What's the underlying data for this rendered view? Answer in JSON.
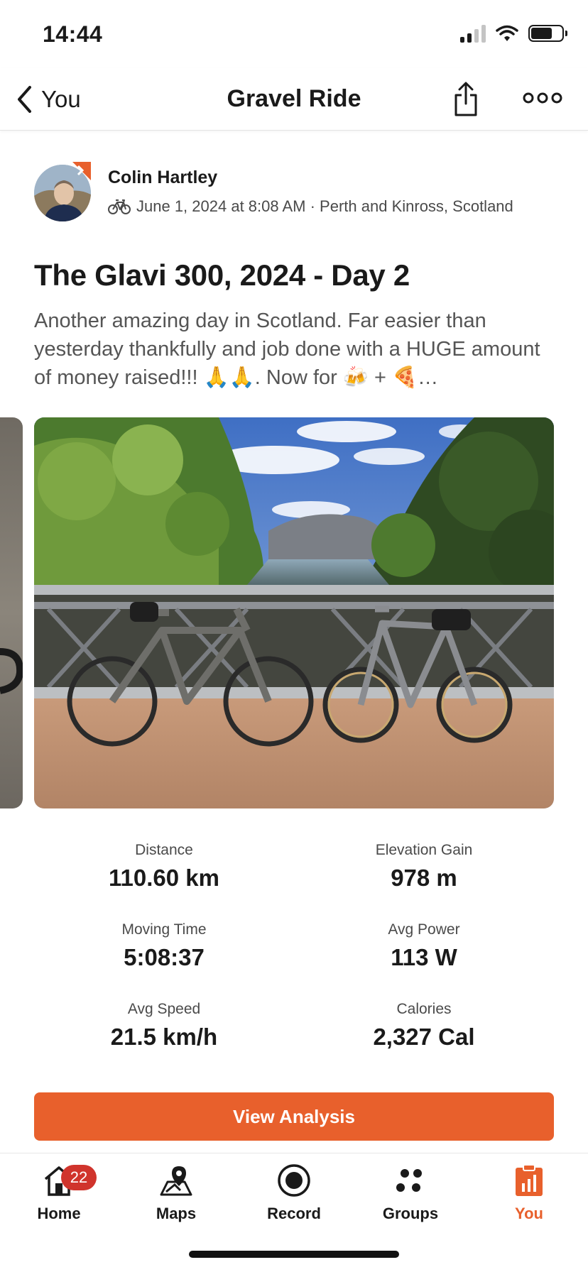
{
  "status_bar": {
    "time": "14:44"
  },
  "header": {
    "back_label": "You",
    "title": "Gravel Ride"
  },
  "author": {
    "name": "Colin Hartley",
    "meta": "June 1, 2024 at 8:08 AM · Perth and Kinross, Scotland"
  },
  "activity": {
    "title": "The Glavi 300, 2024 - Day 2",
    "description": "Another amazing day in Scotland. Far easier than yesterday thankfully and job done with a HUGE amount of money raised!!! 🙏🙏. Now for 🍻 + 🍕…"
  },
  "stats": [
    {
      "label": "Distance",
      "value": "110.60 km"
    },
    {
      "label": "Elevation Gain",
      "value": "978 m"
    },
    {
      "label": "Moving Time",
      "value": "5:08:37"
    },
    {
      "label": "Avg Power",
      "value": "113 W"
    },
    {
      "label": "Avg Speed",
      "value": "21.5 km/h"
    },
    {
      "label": "Calories",
      "value": "2,327 Cal"
    }
  ],
  "actions": {
    "view_analysis": "View Analysis"
  },
  "tab_bar": {
    "home": {
      "label": "Home",
      "badge": "22"
    },
    "maps": {
      "label": "Maps"
    },
    "record": {
      "label": "Record"
    },
    "groups": {
      "label": "Groups"
    },
    "you": {
      "label": "You"
    }
  },
  "colors": {
    "accent": "#e8602c",
    "badge": "#d0342c"
  },
  "icons": [
    "chevron-left-icon",
    "share-icon",
    "more-icon",
    "bike-icon",
    "home-icon",
    "maps-icon",
    "record-icon",
    "groups-icon",
    "you-icon"
  ]
}
